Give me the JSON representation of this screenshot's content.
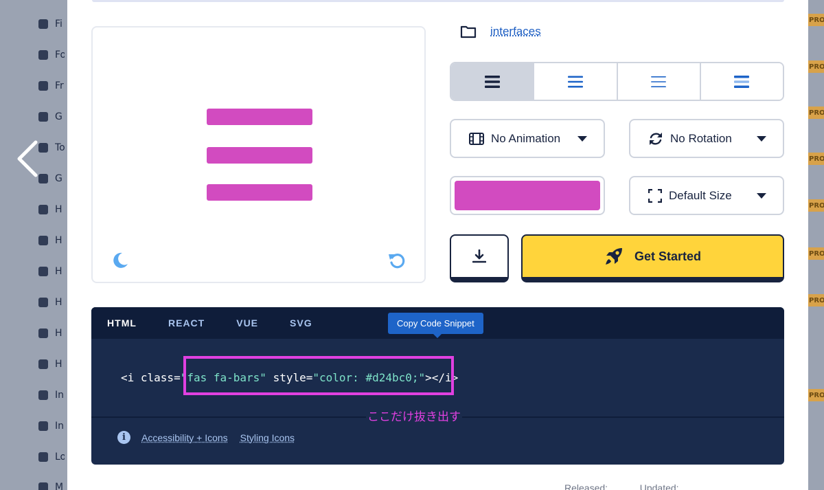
{
  "sidebar": {
    "items": [
      {
        "icon": "building-icon",
        "label": "Fi"
      },
      {
        "icon": "burger-icon",
        "label": "Fo"
      },
      {
        "icon": "apple-icon",
        "label": "Fr"
      },
      {
        "icon": "chess-icon",
        "label": "G"
      },
      {
        "icon": "gear-icon",
        "label": "To"
      },
      {
        "icon": "gender-icon",
        "label": "G"
      },
      {
        "icon": "halloween-icon",
        "label": "H"
      },
      {
        "icon": "hand-icon",
        "label": "H"
      },
      {
        "icon": "heart-pulse-icon",
        "label": "H"
      },
      {
        "icon": "hat-icon",
        "label": "H"
      },
      {
        "icon": "spa-icon",
        "label": "H"
      },
      {
        "icon": "bed-icon",
        "label": "H"
      },
      {
        "icon": "images-icon",
        "label": "In"
      },
      {
        "icon": "clipboard-icon",
        "label": "In"
      },
      {
        "icon": "truck-icon",
        "label": "Lo"
      },
      {
        "icon": "map-icon",
        "label": "M"
      }
    ]
  },
  "right_strip": {
    "pro_label": "PRO"
  },
  "icon_preview": {
    "icon": "bars-icon",
    "color": "#d24bc0"
  },
  "category": {
    "link": "interfaces"
  },
  "style_options": [
    {
      "name": "solid",
      "active": true
    },
    {
      "name": "regular",
      "active": false
    },
    {
      "name": "light",
      "active": false
    },
    {
      "name": "duotone",
      "active": false
    }
  ],
  "animation": {
    "label": "No Animation"
  },
  "rotation": {
    "label": "No Rotation"
  },
  "size": {
    "label": "Default Size"
  },
  "color_picker": {
    "value": "#d24bc0"
  },
  "actions": {
    "get_started": "Get Started"
  },
  "code": {
    "tabs": [
      "HTML",
      "REACT",
      "VUE",
      "SVG"
    ],
    "active_tab": "HTML",
    "tooltip": "Copy Code Snippet",
    "snippet_prefix": "<i class=",
    "snippet_class": "\"fas fa-bars\"",
    "snippet_style_attr": " style=",
    "snippet_style_value": "\"color: #d24bc0;\"",
    "snippet_suffix": "></i>",
    "annotation": "ここだけ抜き出す",
    "links": [
      "Accessibility + Icons",
      "Styling Icons"
    ]
  },
  "colors": {
    "accent": "#d24bc0",
    "navy": "#1a2b4c",
    "yellow": "#ffd43b",
    "link_blue": "#1e5fc3",
    "highlight": "#e040e0"
  },
  "meta": {
    "released": "Released:",
    "updated": "Updated:"
  }
}
